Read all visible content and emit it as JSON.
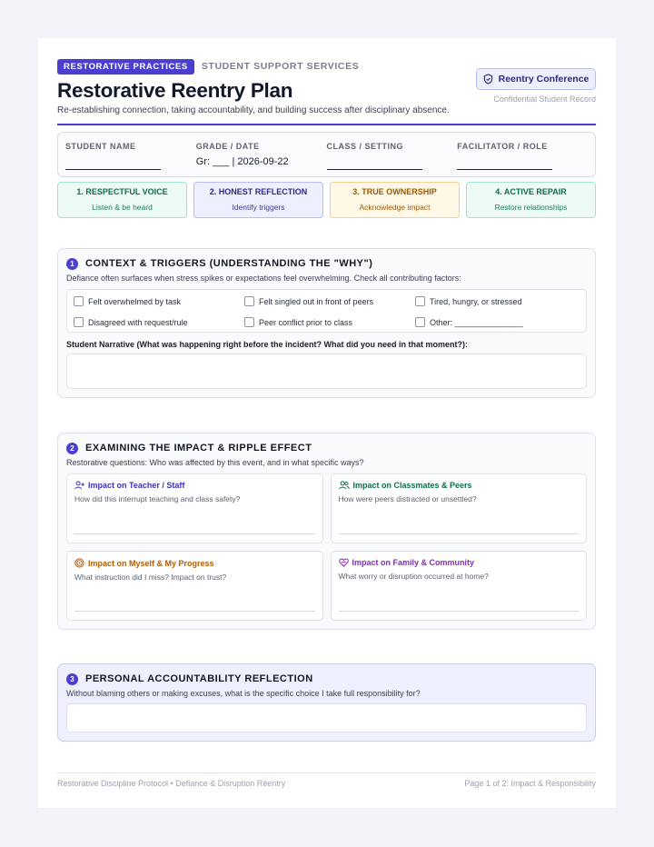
{
  "header": {
    "badge": "RESTORATIVE PRACTICES",
    "department": "STUDENT SUPPORT SERVICES",
    "title": "Restorative Reentry Plan",
    "subtitle": "Re-establishing connection, taking accountability, and building success after disciplinary absence.",
    "conference_button": "Reentry Conference",
    "confidential_note": "Confidential Student Record"
  },
  "fields": [
    {
      "label": "STUDENT NAME",
      "value": ""
    },
    {
      "label": "GRADE / DATE",
      "value": "Gr: ___ | 2026-09-22"
    },
    {
      "label": "CLASS / SETTING",
      "value": ""
    },
    {
      "label": "FACILITATOR / ROLE",
      "value": ""
    }
  ],
  "steps": [
    {
      "title": "1. RESPECTFUL VOICE",
      "sub": "Listen & be heard"
    },
    {
      "title": "2. HONEST REFLECTION",
      "sub": "Identify triggers"
    },
    {
      "title": "3. TRUE OWNERSHIP",
      "sub": "Acknowledge impact"
    },
    {
      "title": "4. ACTIVE REPAIR",
      "sub": "Restore relationships"
    }
  ],
  "section1": {
    "number": "1",
    "title": "CONTEXT & TRIGGERS (UNDERSTANDING THE \"WHY\")",
    "description": "Defiance often surfaces when stress spikes or expectations feel overwhelming. Check all contributing factors:",
    "checks": [
      "Felt overwhelmed by task",
      "Felt singled out in front of peers",
      "Tired, hungry, or stressed",
      "Disagreed with request/rule",
      "Peer conflict prior to class",
      "Other: _______________"
    ],
    "narrative_label": "Student Narrative (What was happening right before the incident? What did you need in that moment?):"
  },
  "section2": {
    "number": "2",
    "title": "EXAMINING THE IMPACT & RIPPLE EFFECT",
    "description": "Restorative questions: Who was affected by this event, and in what specific ways?",
    "cards": [
      {
        "title": "Impact on Teacher / Staff",
        "question": "How did this interrupt teaching and class safety?",
        "color": "#3b33b8"
      },
      {
        "title": "Impact on Classmates & Peers",
        "question": "How were peers distracted or unsettled?",
        "color": "#0f6b4e"
      },
      {
        "title": "Impact on Myself & My Progress",
        "question": "What instruction did I miss? Impact on trust?",
        "color": "#b25c07"
      },
      {
        "title": "Impact on Family & Community",
        "question": "What worry or disruption occurred at home?",
        "color": "#8a2bb8"
      }
    ]
  },
  "section3": {
    "number": "3",
    "title": "PERSONAL ACCOUNTABILITY REFLECTION",
    "description": "Without blaming others or making excuses, what is the specific choice I take full responsibility for?"
  },
  "footer": {
    "left": "Restorative Discipline Protocol • Defiance & Disruption Reentry",
    "right": "Page 1 of 2: Impact & Responsibility"
  }
}
